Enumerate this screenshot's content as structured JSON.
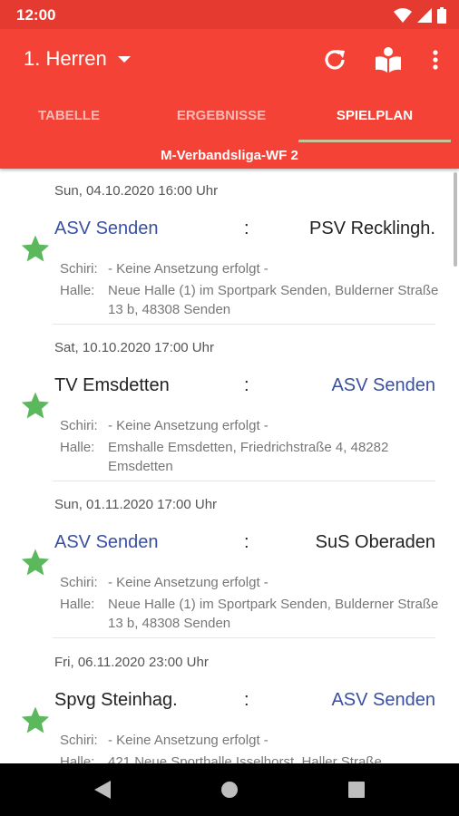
{
  "status_bar": {
    "time": "12:00",
    "icons": [
      "wifi-icon",
      "signal-icon",
      "battery-icon"
    ]
  },
  "app_bar": {
    "team": "1. Herren",
    "actions": [
      "refresh-icon",
      "book-reader-icon",
      "more-vert-icon"
    ]
  },
  "tabs": [
    {
      "label": "TABELLE",
      "active": false
    },
    {
      "label": "ERGEBNISSE",
      "active": false
    },
    {
      "label": "SPIELPLAN",
      "active": true
    }
  ],
  "league": "M-Verbandsliga-WF 2",
  "labels": {
    "referee": "Schiri:",
    "hall": "Halle:",
    "separator": ":"
  },
  "matches": [
    {
      "date": "Sun, 04.10.2020 16:00 Uhr",
      "home": "ASV Senden",
      "away": "PSV Recklingh.",
      "referee": "- Keine Ansetzung erfolgt -",
      "hall": "Neue Halle (1) im Sportpark Senden, Bulderner Straße 13 b, 48308 Senden"
    },
    {
      "date": "Sat, 10.10.2020 17:00 Uhr",
      "home": "TV Emsdetten",
      "away": "ASV Senden",
      "referee": "- Keine Ansetzung erfolgt -",
      "hall": "Emshalle Emsdetten, Friedrichstraße 4, 48282 Emsdetten"
    },
    {
      "date": "Sun, 01.11.2020 17:00 Uhr",
      "home": "ASV Senden",
      "away": "SuS Oberaden",
      "referee": "- Keine Ansetzung erfolgt -",
      "hall": "Neue Halle (1) im Sportpark Senden, Bulderner Straße 13 b, 48308 Senden"
    },
    {
      "date": "Fri, 06.11.2020 23:00 Uhr",
      "home": "Spvg Steinhag.",
      "away": "ASV Senden",
      "referee": "- Keine Ansetzung erfolgt -",
      "hall": "421 Neue Sporthalle Isselhorst, Haller Straße"
    }
  ],
  "nav": [
    "back-icon",
    "home-icon",
    "recents-icon"
  ],
  "colors": {
    "primary": "#f44336",
    "status_bar": "#e53a30",
    "own_team": "#3a4fa1",
    "star": "#5cb85c",
    "tab_indicator": "#c8c39a"
  }
}
